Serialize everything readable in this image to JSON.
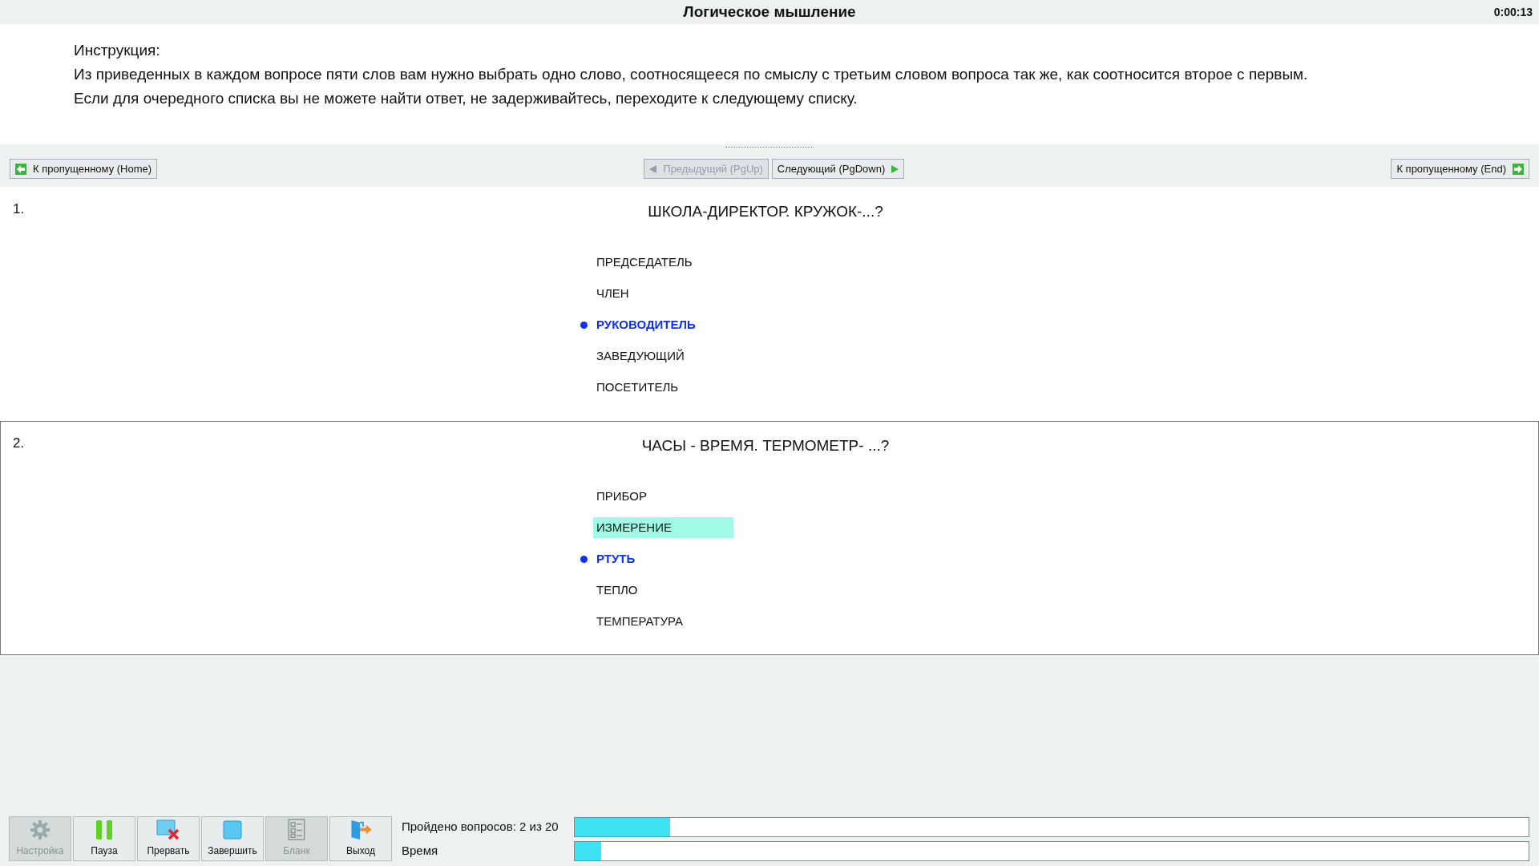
{
  "window": {
    "title": "Логическое мышление",
    "timer": "0:00:13"
  },
  "instruction": {
    "heading": "Инструкция:",
    "lines": [
      "Из приведенных в каждом вопросе пяти слов вам нужно выбрать одно слово, соотносящееся по смыслу с третьим словом вопроса так же, как соотносится второе с первым.",
      "Если для очередного списка вы не можете найти ответ, не задерживайтесь, переходите к следующему списку."
    ]
  },
  "navigation": [
    {
      "kind": "skip-back",
      "label": "К пропущенному (Home)",
      "disabled": false
    },
    {
      "kind": "prev",
      "label": "Предыдущий (PgUp)",
      "disabled": true
    },
    {
      "kind": "next",
      "label": "Следующий (PgDown)",
      "disabled": false
    },
    {
      "kind": "skip-forward",
      "label": "К пропущенному (End)",
      "disabled": false
    }
  ],
  "questions": [
    {
      "number": "1.",
      "text": "ШКОЛА-ДИРЕКТОР. КРУЖОК-...?",
      "current": false,
      "options": [
        {
          "label": "ПРЕДСЕДАТЕЛЬ",
          "selected": false,
          "highlighted": false
        },
        {
          "label": "ЧЛЕН",
          "selected": false,
          "highlighted": false
        },
        {
          "label": "РУКОВОДИТЕЛЬ",
          "selected": true,
          "highlighted": false
        },
        {
          "label": "ЗАВЕДУЮЩИЙ",
          "selected": false,
          "highlighted": false
        },
        {
          "label": "ПОСЕТИТЕЛЬ",
          "selected": false,
          "highlighted": false
        }
      ]
    },
    {
      "number": "2.",
      "text": "ЧАСЫ - ВРЕМЯ. ТЕРМОМЕТР- ...?",
      "current": true,
      "options": [
        {
          "label": "ПРИБОР",
          "selected": false,
          "highlighted": false
        },
        {
          "label": "ИЗМЕРЕНИЕ",
          "selected": false,
          "highlighted": true
        },
        {
          "label": "РТУТЬ",
          "selected": true,
          "highlighted": false
        },
        {
          "label": "ТЕПЛО",
          "selected": false,
          "highlighted": false
        },
        {
          "label": "ТЕМПЕРАТУРА",
          "selected": false,
          "highlighted": false
        }
      ]
    }
  ],
  "toolbar": [
    {
      "kind": "settings",
      "label": "Настройка",
      "disabled": true
    },
    {
      "kind": "pause",
      "label": "Пауза",
      "disabled": false
    },
    {
      "kind": "abort",
      "label": "Прервать",
      "disabled": false
    },
    {
      "kind": "finish",
      "label": "Завершить",
      "disabled": false
    },
    {
      "kind": "form",
      "label": "Бланк",
      "disabled": true
    },
    {
      "kind": "exit",
      "label": "Выход",
      "disabled": false
    }
  ],
  "progress": [
    {
      "label": "Пройдено вопросов: 2 из 20",
      "level": 0.1
    },
    {
      "label": "Время",
      "level": 0.028
    }
  ]
}
